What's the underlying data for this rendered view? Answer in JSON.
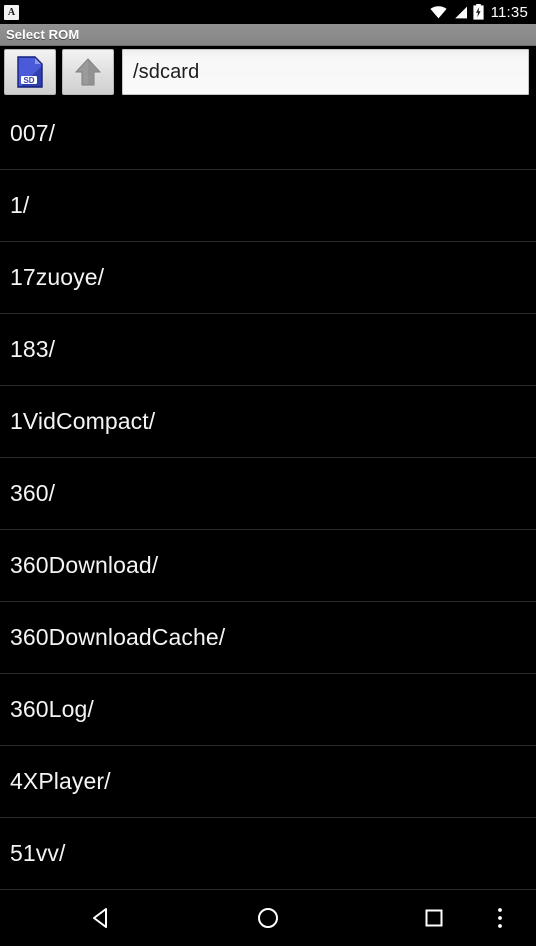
{
  "status_bar": {
    "notification_icon": "app-notification-icon",
    "notification_letter": "A",
    "wifi_icon": "wifi-icon",
    "signal_icon": "cell-signal-icon",
    "battery_icon": "battery-charging-icon",
    "clock": "11:35"
  },
  "title_bar": {
    "title": "Select ROM"
  },
  "toolbar": {
    "sdcard_button": {
      "icon": "sdcard-icon",
      "label": "SD"
    },
    "up_button": {
      "icon": "arrow-up-icon"
    },
    "path_input": {
      "value": "/sdcard",
      "placeholder": "/sdcard"
    }
  },
  "file_list": {
    "items": [
      {
        "name": "007/"
      },
      {
        "name": "1/"
      },
      {
        "name": "17zuoye/"
      },
      {
        "name": "183/"
      },
      {
        "name": "1VidCompact/"
      },
      {
        "name": "360/"
      },
      {
        "name": "360Download/"
      },
      {
        "name": "360DownloadCache/"
      },
      {
        "name": "360Log/"
      },
      {
        "name": "4XPlayer/"
      },
      {
        "name": "51vv/"
      }
    ]
  },
  "nav_bar": {
    "back": "back-icon",
    "home": "home-icon",
    "recents": "recents-icon",
    "overflow": "overflow-menu-icon"
  },
  "colors": {
    "background": "#000000",
    "title_bar": "#8b8b8b",
    "text": "#f4f4f4",
    "divider": "#2a2a2a",
    "sd_blue": "#2233a8"
  }
}
